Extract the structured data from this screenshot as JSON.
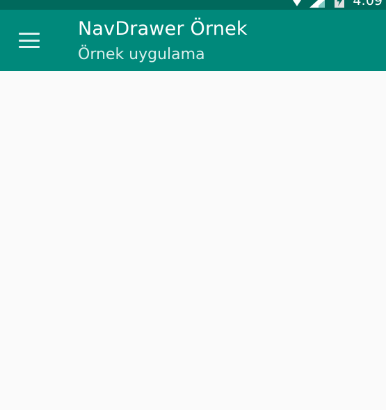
{
  "status_bar": {
    "time": "4:09",
    "icons": [
      "wifi-icon",
      "signal-icon",
      "battery-charging-icon"
    ]
  },
  "toolbar": {
    "menu_icon": "hamburger-menu-icon",
    "title": "NavDrawer Örnek",
    "subtitle": "Örnek uygulama"
  },
  "colors": {
    "status_bar": "#00695c",
    "toolbar": "#00897b",
    "background": "#fafafa",
    "title_text": "#ffffff",
    "subtitle_text": "#d9efec"
  }
}
